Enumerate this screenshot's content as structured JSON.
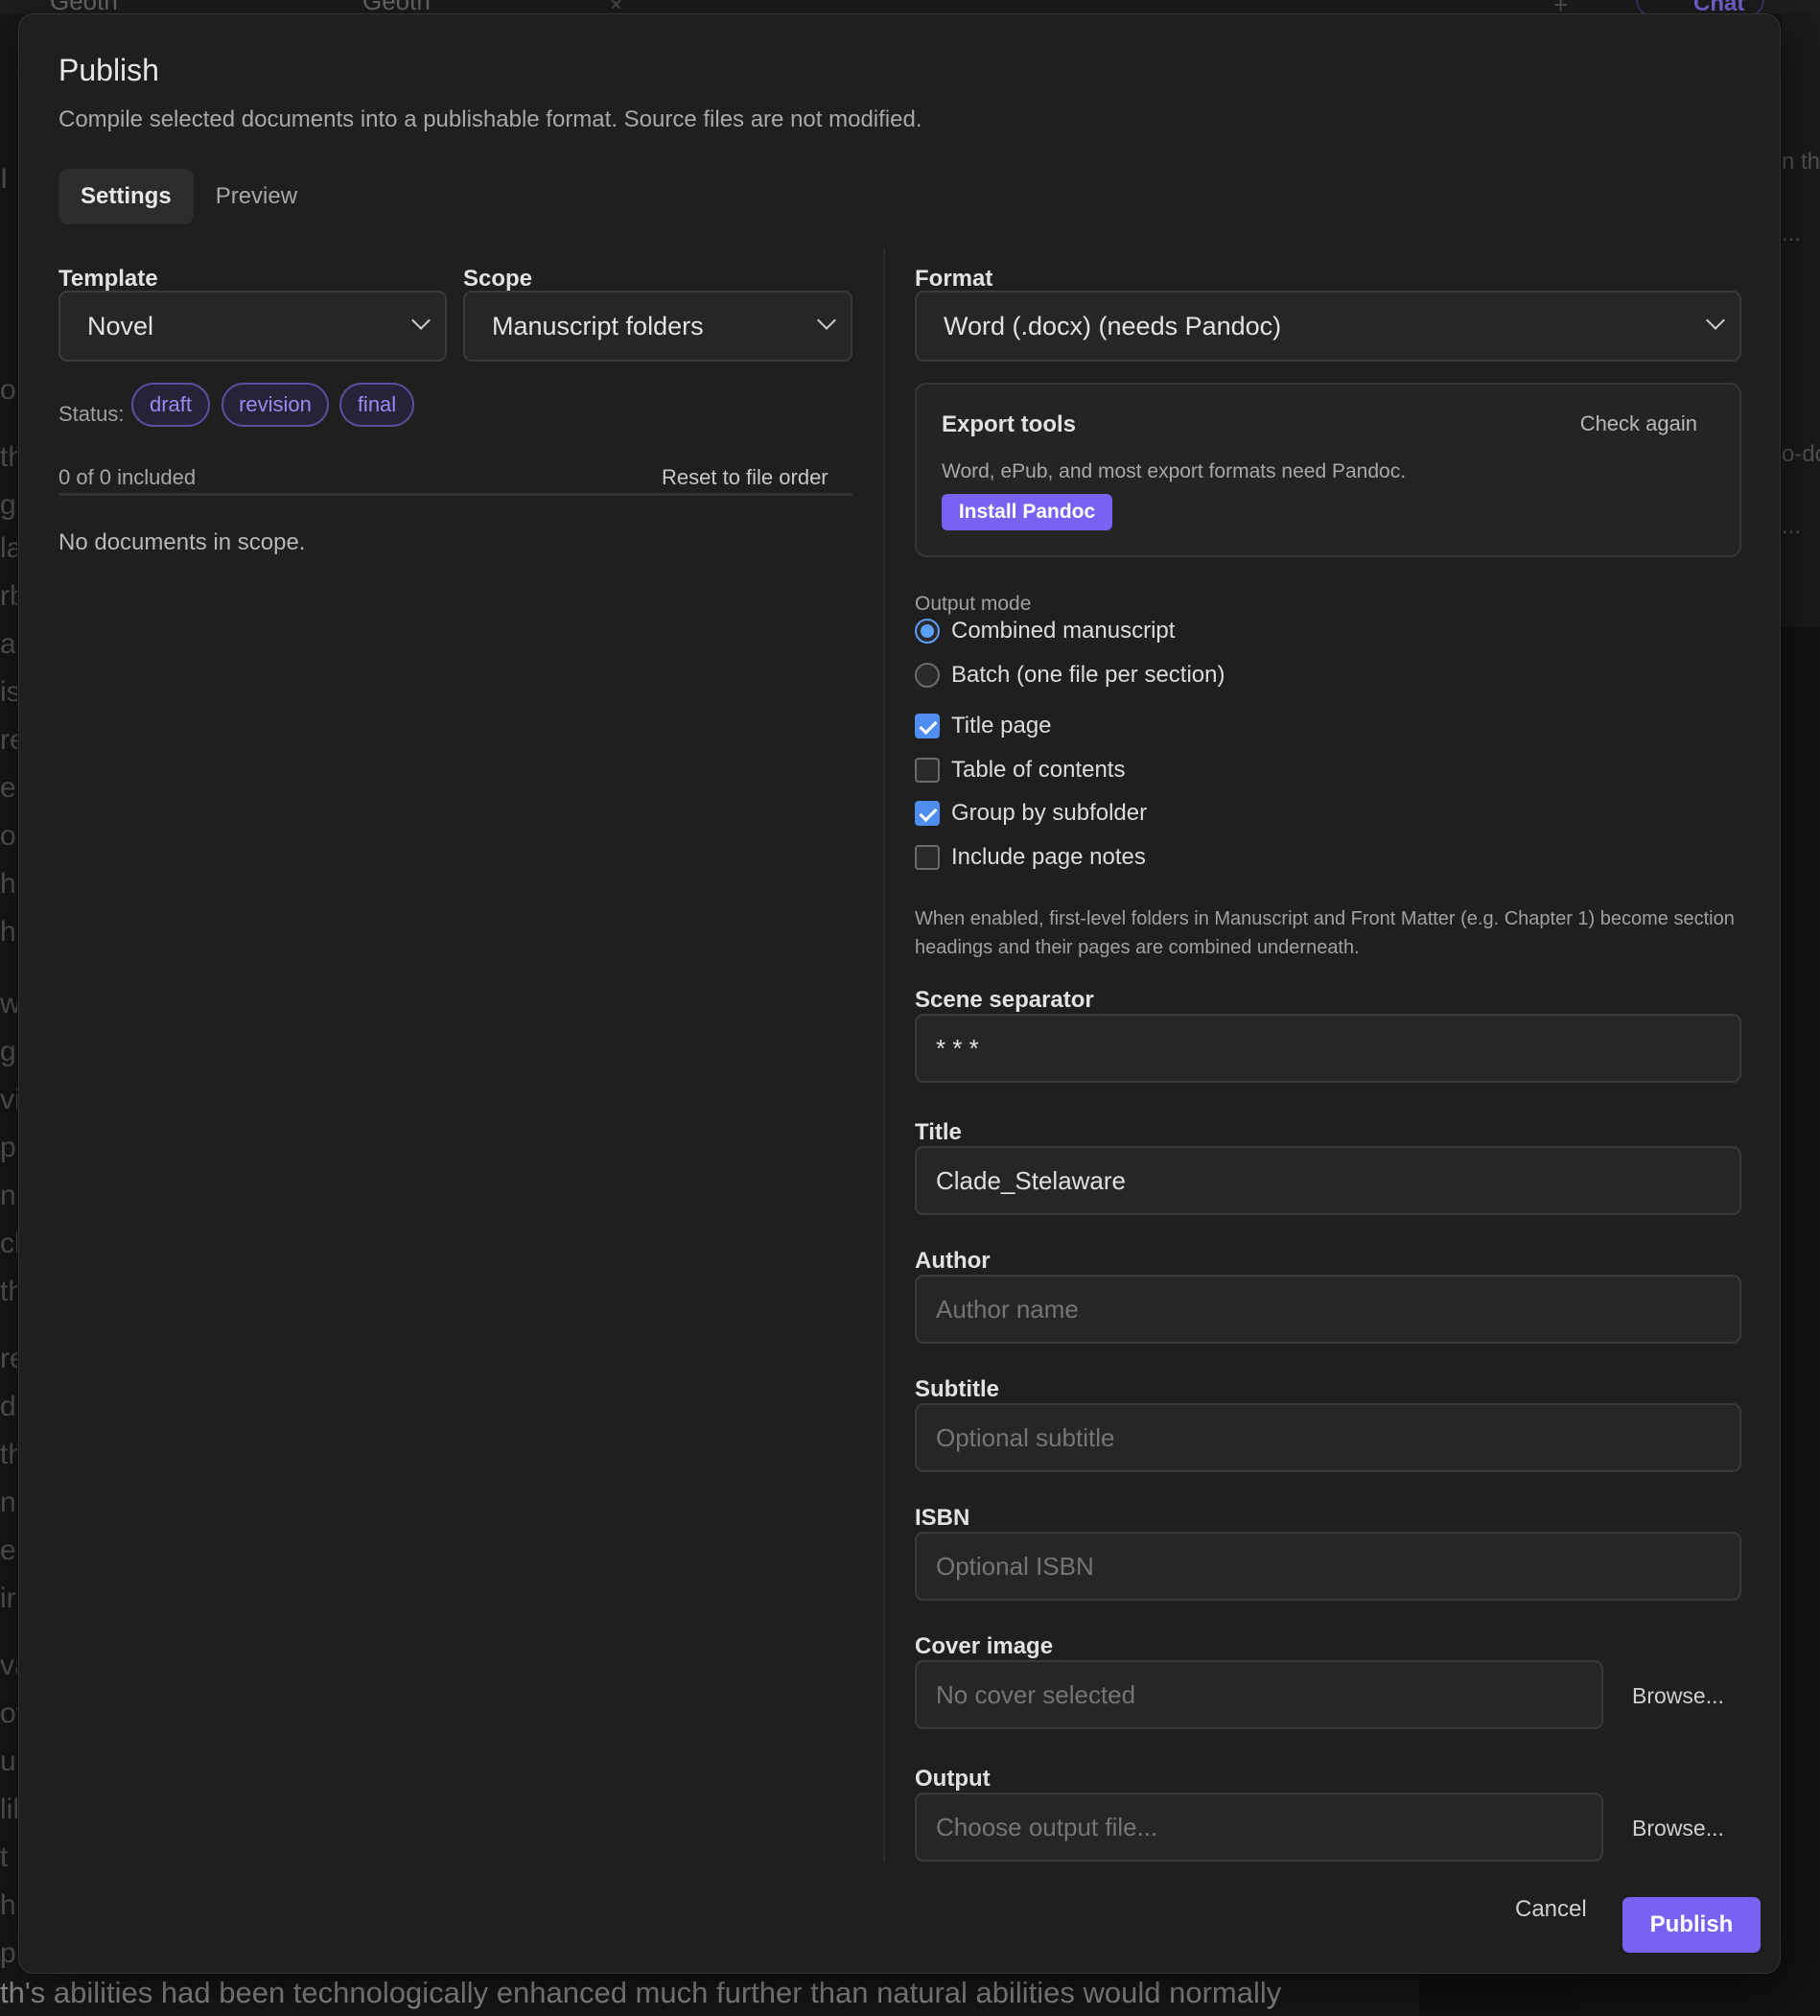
{
  "background": {
    "tabs": [
      "Geoth",
      "Geoth"
    ],
    "chat_label": "Chat",
    "bottom_text": "th's abilities had been technologically enhanced much further than natural abilities would normally",
    "left_glyphs": [
      "I",
      "o",
      "th",
      "g",
      "la",
      "rb",
      "ac",
      "is",
      "re",
      "es",
      "o",
      "he",
      "ha",
      "w",
      "g",
      "vi",
      "p",
      "nc",
      "ch",
      "th",
      "re",
      "de",
      "th",
      "n",
      "e",
      "ir",
      "va",
      "ot",
      "ur",
      "lil",
      "t",
      "he",
      "pa"
    ],
    "right_glyphs": [
      "n th",
      "...",
      "o-do",
      "..."
    ]
  },
  "modal": {
    "title": "Publish",
    "subtitle": "Compile selected documents into a publishable format. Source files are not modified.",
    "tabs": [
      {
        "label": "Settings",
        "active": true
      },
      {
        "label": "Preview",
        "active": false
      }
    ],
    "template": {
      "label": "Template",
      "value": "Novel"
    },
    "scope": {
      "label": "Scope",
      "value": "Manuscript folders"
    },
    "status": {
      "label": "Status:",
      "pills": [
        "draft",
        "revision",
        "final"
      ]
    },
    "included_text": "0 of 0 included",
    "reset_label": "Reset to file order",
    "no_docs_text": "No documents in scope.",
    "format": {
      "label": "Format",
      "value": "Word (.docx) (needs Pandoc)"
    },
    "export_tools": {
      "title": "Export tools",
      "check_again": "Check again",
      "description": "Word, ePub, and most export formats need Pandoc.",
      "install_label": "Install Pandoc"
    },
    "output_mode": {
      "label": "Output mode",
      "options": [
        {
          "label": "Combined manuscript",
          "selected": true
        },
        {
          "label": "Batch (one file per section)",
          "selected": false
        }
      ]
    },
    "checkboxes": [
      {
        "label": "Title page",
        "checked": true
      },
      {
        "label": "Table of contents",
        "checked": false
      },
      {
        "label": "Group by subfolder",
        "checked": true
      },
      {
        "label": "Include page notes",
        "checked": false
      }
    ],
    "help_text": "When enabled, first-level folders in Manuscript and Front Matter (e.g. Chapter 1) become section headings and their pages are combined underneath.",
    "scene_separator": {
      "label": "Scene separator",
      "value": "* * *"
    },
    "title_field": {
      "label": "Title",
      "value": "Clade_Stelaware"
    },
    "author_field": {
      "label": "Author",
      "placeholder": "Author name"
    },
    "subtitle_field": {
      "label": "Subtitle",
      "placeholder": "Optional subtitle"
    },
    "isbn_field": {
      "label": "ISBN",
      "placeholder": "Optional ISBN"
    },
    "cover_field": {
      "label": "Cover image",
      "placeholder": "No cover selected",
      "browse_label": "Browse..."
    },
    "output_field": {
      "label": "Output",
      "placeholder": "Choose output file...",
      "browse_label": "Browse..."
    },
    "cancel_label": "Cancel",
    "publish_label": "Publish",
    "colors": {
      "accent": "#7b61f2",
      "checkbox": "#4f8ef0",
      "pill_text": "#9b8bf0"
    }
  }
}
